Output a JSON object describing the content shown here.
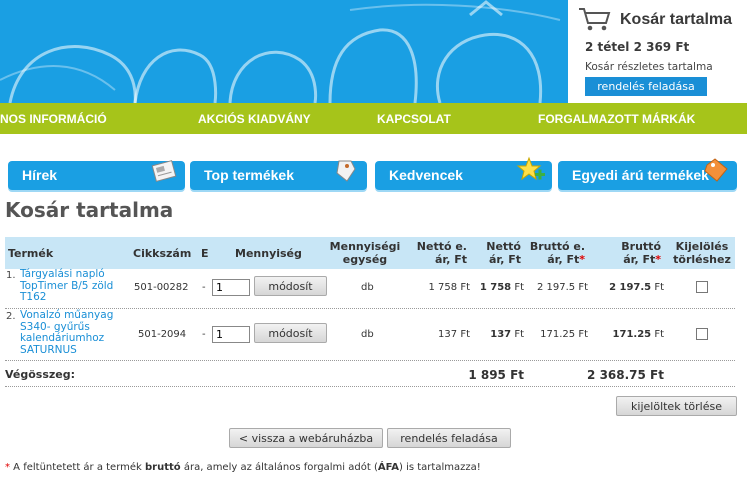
{
  "cart_box": {
    "title": "Kosár tartalma",
    "summary": "2 tétel 2 369 Ft",
    "details_link": "Kosár részletes tartalma",
    "order_button": "rendelés feladása"
  },
  "nav": {
    "items": [
      "NOS INFORMÁCIÓ",
      "AKCIÓS KIADVÁNY",
      "KAPCSOLAT",
      "FORGALMAZOTT MÁRKÁK"
    ]
  },
  "tabs": [
    "Hírek",
    "Top termékek",
    "Kedvencek",
    "Egyedi árú termékek"
  ],
  "page_title": "Kosár tartalma",
  "table": {
    "headers": {
      "product": "Termék",
      "sku": "Cikkszám",
      "e": "E",
      "quantity": "Mennyiség",
      "unit_line1": "Mennyiségi",
      "unit_line2": "egység",
      "net_unit_line1": "Nettó e.",
      "net_unit_line2": "ár, Ft",
      "net_line1": "Nettó",
      "net_line2": "ár, Ft",
      "gross_unit_line1": "Bruttó e.",
      "gross_unit_line2": "ár, Ft",
      "gross_line1": "Bruttó",
      "gross_line2": "ár, Ft",
      "select_line1": "Kijelölés",
      "select_line2": "törléshez",
      "star": "*"
    },
    "rows": [
      {
        "num": "1.",
        "name": "Tárgyalási napló TopTimer B/5 zöld T162",
        "sku": "501-00282",
        "e": "-",
        "qty": "1",
        "modify": "módosít",
        "unit": "db",
        "net_unit": "1 758 Ft",
        "net": "1 758",
        "net_suffix": " Ft",
        "gross_unit": "2 197.5 Ft",
        "gross": "2 197.5",
        "gross_suffix": " Ft"
      },
      {
        "num": "2.",
        "name": "Vonalzó műanyag S340- gyűrűs kalendáriumhoz SATURNUS",
        "sku": "501-2094",
        "e": "-",
        "qty": "1",
        "modify": "módosít",
        "unit": "db",
        "net_unit": "137 Ft",
        "net": "137",
        "net_suffix": " Ft",
        "gross_unit": "171.25 Ft",
        "gross": "171.25",
        "gross_suffix": " Ft"
      }
    ],
    "total_label": "Végösszeg:",
    "total_net": "1 895 Ft",
    "total_gross": "2 368.75 Ft"
  },
  "buttons": {
    "delete_selected": "kijelöltek törlése",
    "back": "< vissza a webáruházba",
    "order": "rendelés feladása"
  },
  "footnote": {
    "star": "*",
    "p1": " A feltüntetett ár a termék ",
    "b1": "bruttó",
    "p2": " ára, amely az általános forgalmi adót (",
    "b2": "ÁFA",
    "p3": ") is tartalmazza!"
  },
  "colors": {
    "header_blue": "#1a9fe3",
    "nav_green": "#a6c41a",
    "link_blue": "#1a8fd6",
    "table_header": "#c8e6f6"
  }
}
